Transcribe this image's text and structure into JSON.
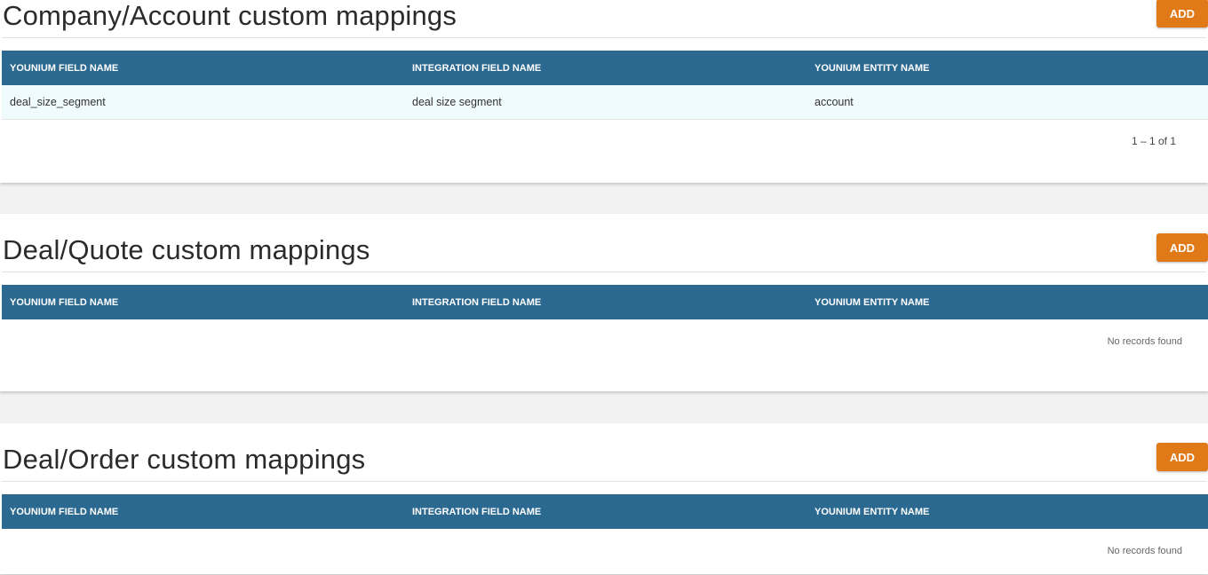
{
  "columns": [
    "YOUNIUM FIELD NAME",
    "INTEGRATION FIELD NAME",
    "YOUNIUM ENTITY NAME"
  ],
  "sections": [
    {
      "title": "Company/Account custom mappings",
      "add_label": "ADD",
      "rows": [
        [
          "deal_size_segment",
          "deal  size  segment",
          "account"
        ]
      ],
      "paginator": "1 – 1 of 1"
    },
    {
      "title": "Deal/Quote custom mappings",
      "add_label": "ADD",
      "rows": [],
      "empty_text": "No records found"
    },
    {
      "title": "Deal/Order custom mappings",
      "add_label": "ADD",
      "rows": [],
      "empty_text": "No records found"
    }
  ]
}
